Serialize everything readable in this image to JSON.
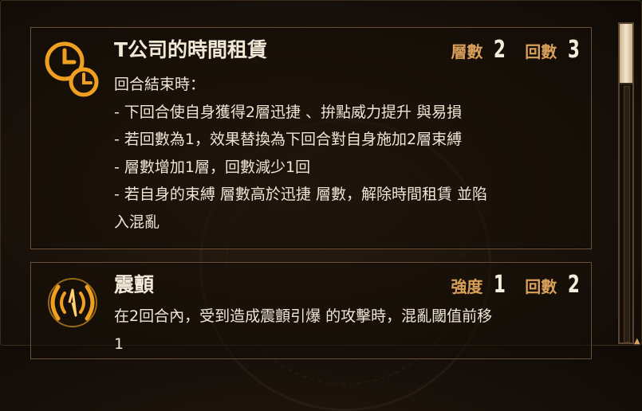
{
  "cards": [
    {
      "title": "T公司的時間租賃",
      "stat1_label": "層數",
      "stat1_value": "2",
      "stat2_label": "回數",
      "stat2_value": "3",
      "icon": "clock-icon",
      "lines": [
        "回合結束時：",
        "- 下回合使自身獲得2層迅捷 、拚點威力提升 與易損",
        "- 若回數為1，效果替換為下回合對自身施加2層束縛",
        "- 層數增加1層，回數減少1回",
        "- 若自身的束縛 層數高於迅捷 層數，解除時間租賃 並陷",
        "入混亂"
      ]
    },
    {
      "title": "震顫",
      "stat1_label": "強度",
      "stat1_value": "1",
      "stat2_label": "回數",
      "stat2_value": "2",
      "icon": "tremor-icon",
      "lines": [
        "在2回合內，受到造成震顫引爆 的攻擊時，混亂閾值前移",
        "1"
      ]
    }
  ],
  "colors": {
    "accent": "#d9a05a",
    "icon": "#f0a020",
    "text": "#efe6d6",
    "border": "#6e5236"
  }
}
